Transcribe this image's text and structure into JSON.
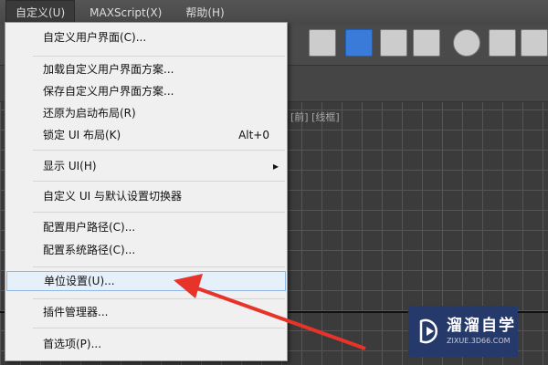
{
  "menubar": [
    "自定义(U)",
    "MAXScript(X)",
    "帮助(H)"
  ],
  "viewport_label": "[前] [线框]",
  "menu": {
    "items": [
      {
        "label": "自定义用户界面(C)..."
      },
      {
        "label": "加载自定义用户界面方案..."
      },
      {
        "label": "保存自定义用户界面方案..."
      },
      {
        "label": "还原为启动布局(R)"
      },
      {
        "label": "锁定 UI 布局(K)",
        "shortcut": "Alt+0"
      },
      {
        "label": "显示 UI(H)",
        "submenu": "▸"
      },
      {
        "label": "自定义 UI 与默认设置切换器"
      },
      {
        "label": "配置用户路径(C)..."
      },
      {
        "label": "配置系统路径(C)..."
      },
      {
        "label": "单位设置(U)..."
      },
      {
        "label": "插件管理器..."
      },
      {
        "label": "首选项(P)..."
      }
    ]
  },
  "watermark": {
    "title": "溜溜自学",
    "url": "ZIXUE.3D66.COM"
  },
  "colors": {
    "arrow": "#e8332a",
    "highlight": "#e5f0fb",
    "logo_bg": "#253a6b"
  }
}
